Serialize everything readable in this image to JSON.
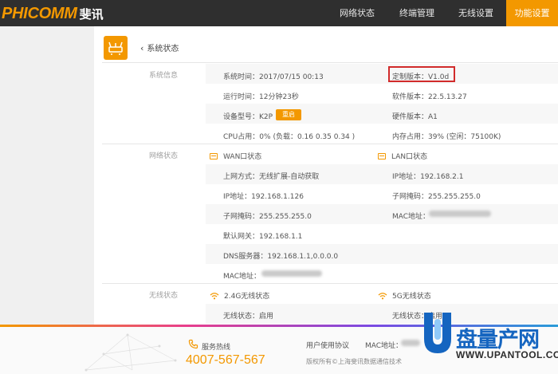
{
  "brand": {
    "name_en": "PHICOMM",
    "name_cn": "斐讯"
  },
  "nav": [
    {
      "label": "网络状态",
      "active": false
    },
    {
      "label": "终端管理",
      "active": false
    },
    {
      "label": "无线设置",
      "active": false
    },
    {
      "label": "功能设置",
      "active": true
    }
  ],
  "page": {
    "back_label": "系统状态"
  },
  "system_info": {
    "section_label": "系统信息",
    "system_time": "系统时间：2017/07/15 00:13",
    "firmware_custom": "定制版本：V1.0d",
    "uptime": "运行时间：12分钟23秒",
    "software_version": "软件版本：22.5.13.27",
    "device_model": "设备型号：K2P",
    "reboot_label": "重启",
    "hardware_version": "硬件版本：A1",
    "cpu": "CPU占用：0% (负载：0.16 0.35 0.34 )",
    "memory": "内存占用：39% (空闲：75100K)"
  },
  "network_status": {
    "section_label": "网络状态",
    "wan": {
      "title": "WAN口状态",
      "mode": "上网方式：无线扩展-自动获取",
      "ip": "IP地址：192.168.1.126",
      "mask": "子网掩码：255.255.255.0",
      "gateway": "默认网关：192.168.1.1",
      "dns": "DNS服务器：192.168.1.1,0.0.0.0",
      "mac": "MAC地址："
    },
    "lan": {
      "title": "LAN口状态",
      "ip": "IP地址：192.168.2.1",
      "mask": "子网掩码：255.255.255.0",
      "mac": "MAC地址："
    }
  },
  "wireless_status": {
    "section_label": "无线状态",
    "band24": {
      "title": "2.4G无线状态",
      "status": "无线状态：启用"
    },
    "band5": {
      "title": "5G无线状态",
      "status": "无线状态：启用"
    }
  },
  "footer": {
    "hotline_label": "服务热线",
    "hotline_number": "4007-567-567",
    "user_agreement": "用户使用协议",
    "mac_label": "MAC地址：",
    "copyright": "版权所有©上海斐讯数据通信技术"
  },
  "watermark": {
    "title": "盘量产网",
    "url": "WWW.UPANTOOL.COM"
  },
  "colors": {
    "accent": "#f39800",
    "topbar": "#2f2f2f",
    "highlight_border": "#d12b2b",
    "watermark_blue": "#1565c0"
  }
}
